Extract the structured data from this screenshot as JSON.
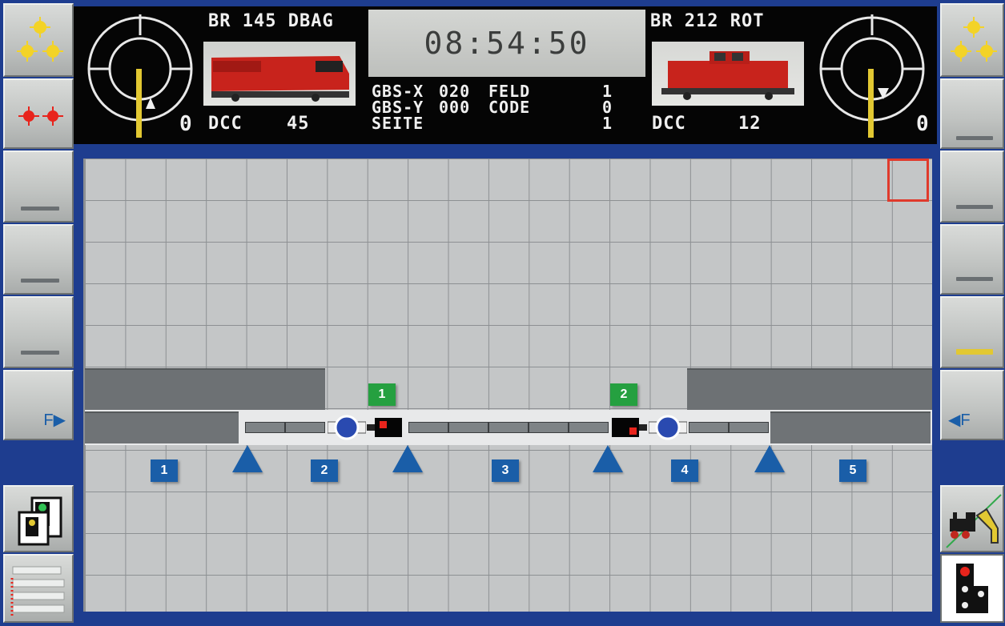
{
  "header": {
    "loco_left": {
      "name": "BR 145 DBAG",
      "speed": "0",
      "protocol": "DCC",
      "address": "45",
      "direction": "forward"
    },
    "loco_right": {
      "name": "BR 212 ROT",
      "speed": "0",
      "protocol": "DCC",
      "address": "12",
      "direction": "reverse"
    },
    "clock": "08:54:50",
    "info": {
      "gbs_x_label": "GBS-X",
      "gbs_x_value": "020",
      "gbs_y_label": "GBS-Y",
      "gbs_y_value": "000",
      "seite_label": "SEITE",
      "feld_label": "FELD",
      "feld_value": "1",
      "code_label": "CODE",
      "code_value": "0",
      "seite_value": "1"
    }
  },
  "left_panel": {
    "f_button_label": "F▶"
  },
  "right_panel": {
    "f_button_label": "◀F"
  },
  "track": {
    "section_labels": [
      "1",
      "2",
      "3",
      "4",
      "5"
    ],
    "signal_labels": [
      "1",
      "2"
    ]
  },
  "colors": {
    "background": "#1e3d8f",
    "grid": "#c4c6c7",
    "badge_blue": "#1a5ea8",
    "badge_green": "#25a040",
    "selection": "#e03a2c",
    "speed_bar": "#e2c832"
  }
}
